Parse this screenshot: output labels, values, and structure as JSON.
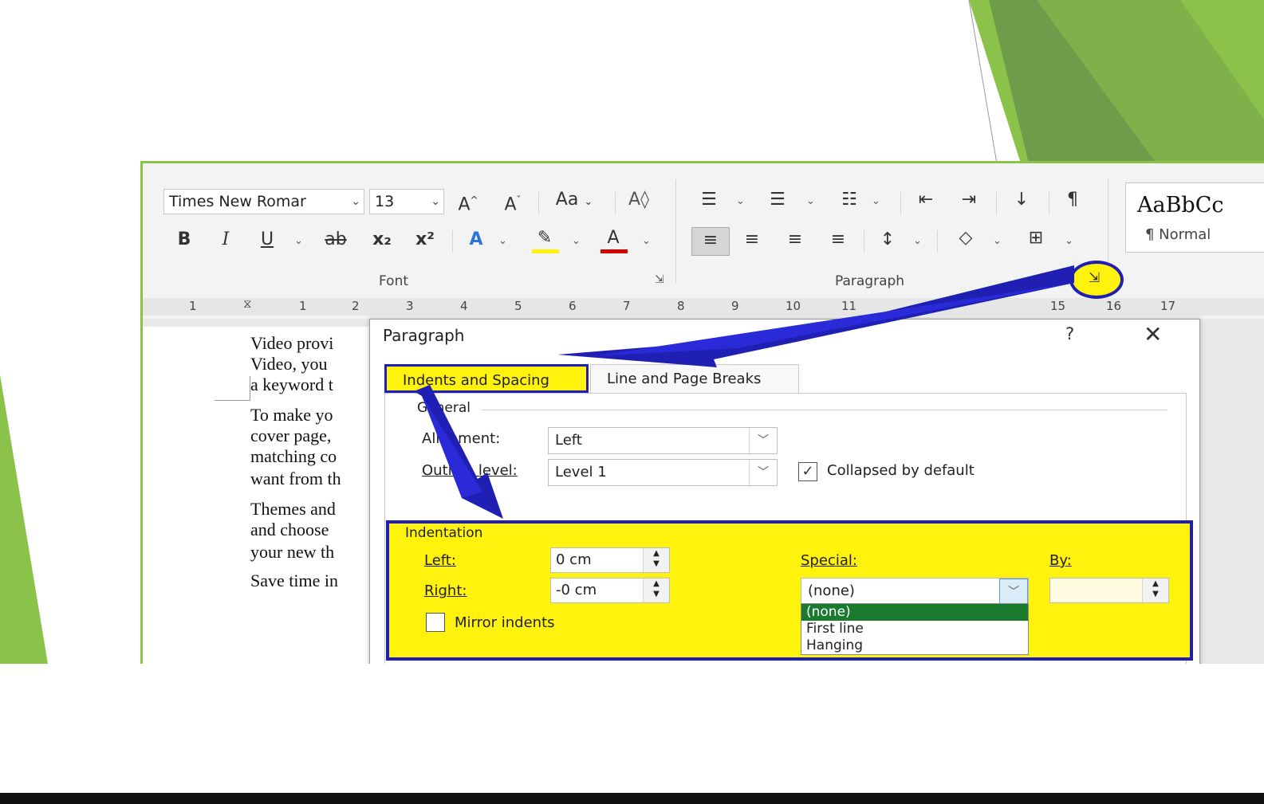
{
  "ribbon": {
    "font_name": "Times New Romar",
    "font_size": "13",
    "bold_label": "B",
    "italic_label": "I",
    "underline_label": "U",
    "strike_label": "ab",
    "subscript_label": "x₂",
    "superscript_label": "x²",
    "change_case_label": "Aa",
    "grow_font_label": "A",
    "shrink_font_label": "A",
    "font_group": "Font",
    "paragraph_group": "Paragraph",
    "styles_preview": "AaBbCc",
    "styles_name": "¶ Normal"
  },
  "ruler": {
    "marks": [
      "1",
      "1",
      "2",
      "3",
      "4",
      "5",
      "6",
      "7",
      "8",
      "9",
      "10",
      "11",
      "15",
      "16",
      "17"
    ]
  },
  "document": {
    "lines": [
      "Video provi",
      "Video, you",
      "a keyword t",
      "To make yo",
      "cover page,",
      "matching co",
      "want from th",
      "Themes and",
      "and choose",
      "your new th",
      "Save time in"
    ]
  },
  "dialog": {
    "title": "Paragraph",
    "help": "?",
    "close": "✕",
    "tabs": [
      "Indents and Spacing",
      "Line and Page Breaks"
    ],
    "general": {
      "legend": "General",
      "alignment_label": "Alignment:",
      "alignment_value": "Left",
      "outline_label": "Outline level:",
      "outline_value": "Level 1",
      "collapsed_label": "Collapsed by default"
    },
    "indentation": {
      "legend": "Indentation",
      "left_label": "Left:",
      "left_value": "0 cm",
      "right_label": "Right:",
      "right_value": "-0 cm",
      "special_label": "Special:",
      "special_value": "(none)",
      "by_label": "By:",
      "mirror_label": "Mirror indents",
      "special_options": [
        "(none)",
        "First line",
        "Hanging"
      ]
    }
  },
  "colors": {
    "highlight": "#fff20c",
    "annotation_blue": "#1f1fb4",
    "accent_green": "#8bc34a",
    "selected_option": "#1a7a2e"
  }
}
